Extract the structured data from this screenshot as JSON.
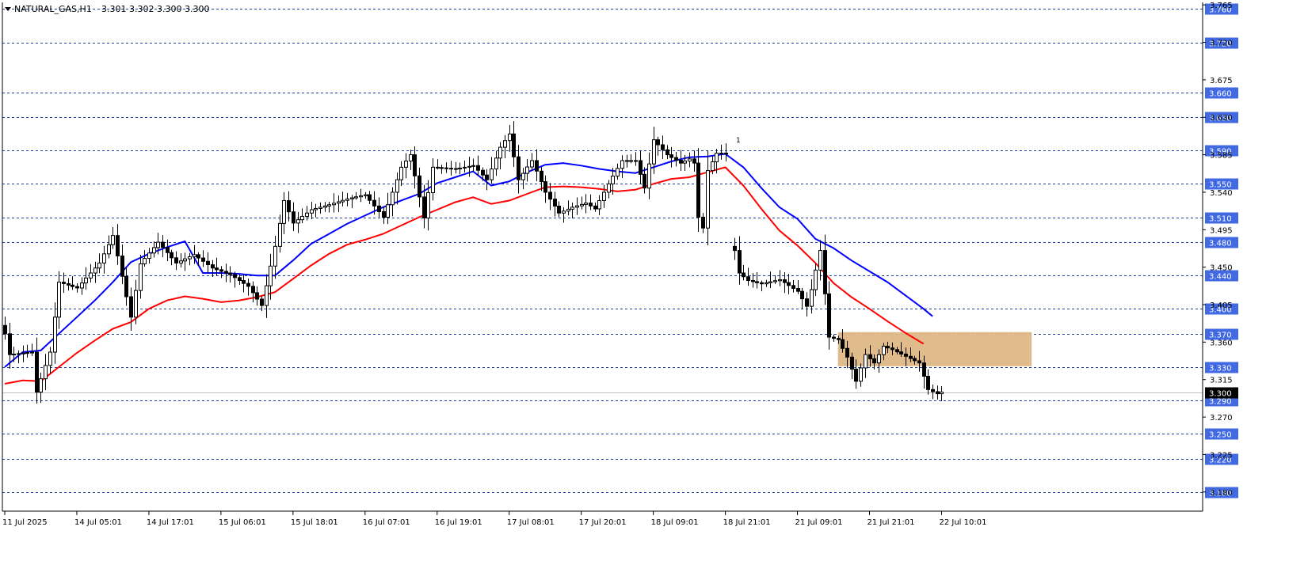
{
  "chart_data": {
    "type": "candlestick",
    "title": "NATURAL_GAS,H1",
    "ohlc_readout": "3.301 3.302 3.300 3.300",
    "current_price": 3.3,
    "ylim": [
      3.157,
      3.768
    ],
    "y_ticks": [
      3.18,
      3.225,
      3.27,
      3.315,
      3.36,
      3.405,
      3.45,
      3.495,
      3.54,
      3.585,
      3.63,
      3.675,
      3.72,
      3.765
    ],
    "x_ticks": [
      {
        "label": "11 Jul 2025",
        "bar": 0
      },
      {
        "label": "14 Jul 05:01",
        "bar": 16
      },
      {
        "label": "14 Jul 17:01",
        "bar": 32
      },
      {
        "label": "15 Jul 06:01",
        "bar": 48
      },
      {
        "label": "15 Jul 18:01",
        "bar": 64
      },
      {
        "label": "16 Jul 07:01",
        "bar": 80
      },
      {
        "label": "16 Jul 19:01",
        "bar": 96
      },
      {
        "label": "17 Jul 08:01",
        "bar": 112
      },
      {
        "label": "17 Jul 20:01",
        "bar": 128
      },
      {
        "label": "18 Jul 09:01",
        "bar": 144
      },
      {
        "label": "18 Jul 21:01",
        "bar": 160
      },
      {
        "label": "21 Jul 09:01",
        "bar": 176
      },
      {
        "label": "21 Jul 21:01",
        "bar": 192
      },
      {
        "label": "22 Jul 10:01",
        "bar": 208
      }
    ],
    "levels": [
      3.76,
      3.72,
      3.66,
      3.63,
      3.59,
      3.55,
      3.51,
      3.48,
      3.44,
      3.4,
      3.37,
      3.33,
      3.29,
      3.25,
      3.22,
      3.18
    ],
    "zone": {
      "bar_start": 185,
      "bar_end": 228,
      "price_low": 3.331,
      "price_high": 3.372,
      "color": "#deb887"
    },
    "series": [
      {
        "key": "ma_fast",
        "color": "#0000ff",
        "points": [
          [
            0,
            3.33
          ],
          [
            4,
            3.348
          ],
          [
            8,
            3.35
          ],
          [
            12,
            3.37
          ],
          [
            16,
            3.39
          ],
          [
            20,
            3.41
          ],
          [
            24,
            3.432
          ],
          [
            28,
            3.456
          ],
          [
            32,
            3.466
          ],
          [
            36,
            3.474
          ],
          [
            40,
            3.481
          ],
          [
            44,
            3.443
          ],
          [
            48,
            3.443
          ],
          [
            52,
            3.442
          ],
          [
            56,
            3.44
          ],
          [
            60,
            3.44
          ],
          [
            64,
            3.458
          ],
          [
            68,
            3.478
          ],
          [
            72,
            3.49
          ],
          [
            76,
            3.502
          ],
          [
            80,
            3.512
          ],
          [
            84,
            3.522
          ],
          [
            88,
            3.53
          ],
          [
            92,
            3.538
          ],
          [
            96,
            3.551
          ],
          [
            100,
            3.558
          ],
          [
            104,
            3.565
          ],
          [
            108,
            3.548
          ],
          [
            112,
            3.553
          ],
          [
            116,
            3.564
          ],
          [
            120,
            3.573
          ],
          [
            124,
            3.575
          ],
          [
            128,
            3.572
          ],
          [
            132,
            3.568
          ],
          [
            136,
            3.565
          ],
          [
            140,
            3.563
          ],
          [
            144,
            3.57
          ],
          [
            148,
            3.577
          ],
          [
            152,
            3.582
          ],
          [
            156,
            3.583
          ],
          [
            160,
            3.586
          ],
          [
            164,
            3.57
          ],
          [
            168,
            3.545
          ],
          [
            172,
            3.522
          ],
          [
            176,
            3.508
          ],
          [
            180,
            3.484
          ],
          [
            184,
            3.473
          ],
          [
            188,
            3.458
          ],
          [
            192,
            3.445
          ],
          [
            196,
            3.432
          ],
          [
            200,
            3.416
          ],
          [
            204,
            3.4
          ],
          [
            206,
            3.391
          ]
        ]
      },
      {
        "key": "ma_slow",
        "color": "#ff0000",
        "points": [
          [
            0,
            3.31
          ],
          [
            4,
            3.314
          ],
          [
            8,
            3.313
          ],
          [
            12,
            3.33
          ],
          [
            16,
            3.347
          ],
          [
            20,
            3.362
          ],
          [
            24,
            3.376
          ],
          [
            28,
            3.384
          ],
          [
            32,
            3.4
          ],
          [
            36,
            3.41
          ],
          [
            40,
            3.415
          ],
          [
            44,
            3.412
          ],
          [
            48,
            3.408
          ],
          [
            52,
            3.41
          ],
          [
            56,
            3.414
          ],
          [
            60,
            3.42
          ],
          [
            64,
            3.436
          ],
          [
            68,
            3.452
          ],
          [
            72,
            3.466
          ],
          [
            76,
            3.477
          ],
          [
            80,
            3.483
          ],
          [
            84,
            3.49
          ],
          [
            88,
            3.5
          ],
          [
            92,
            3.51
          ],
          [
            96,
            3.519
          ],
          [
            100,
            3.528
          ],
          [
            104,
            3.534
          ],
          [
            108,
            3.526
          ],
          [
            112,
            3.53
          ],
          [
            116,
            3.538
          ],
          [
            120,
            3.546
          ],
          [
            124,
            3.547
          ],
          [
            128,
            3.546
          ],
          [
            132,
            3.544
          ],
          [
            136,
            3.541
          ],
          [
            140,
            3.543
          ],
          [
            144,
            3.55
          ],
          [
            148,
            3.556
          ],
          [
            152,
            3.558
          ],
          [
            156,
            3.564
          ],
          [
            160,
            3.57
          ],
          [
            164,
            3.548
          ],
          [
            168,
            3.52
          ],
          [
            172,
            3.494
          ],
          [
            176,
            3.476
          ],
          [
            180,
            3.455
          ],
          [
            184,
            3.431
          ],
          [
            188,
            3.414
          ],
          [
            192,
            3.4
          ],
          [
            196,
            3.385
          ],
          [
            200,
            3.371
          ],
          [
            204,
            3.358
          ]
        ]
      }
    ],
    "key_points": [
      [
        0,
        3.37
      ],
      [
        1,
        3.345
      ],
      [
        6,
        3.348
      ],
      [
        7,
        3.3
      ],
      [
        10,
        3.348
      ],
      [
        12,
        3.432
      ],
      [
        16,
        3.425
      ],
      [
        21,
        3.455
      ],
      [
        24,
        3.488
      ],
      [
        28,
        3.39
      ],
      [
        30,
        3.454
      ],
      [
        34,
        3.48
      ],
      [
        38,
        3.455
      ],
      [
        42,
        3.465
      ],
      [
        46,
        3.449
      ],
      [
        50,
        3.441
      ],
      [
        54,
        3.427
      ],
      [
        57,
        3.404
      ],
      [
        60,
        3.475
      ],
      [
        62,
        3.53
      ],
      [
        64,
        3.503
      ],
      [
        68,
        3.519
      ],
      [
        72,
        3.525
      ],
      [
        76,
        3.532
      ],
      [
        80,
        3.537
      ],
      [
        84,
        3.51
      ],
      [
        88,
        3.57
      ],
      [
        90,
        3.585
      ],
      [
        93,
        3.509
      ],
      [
        95,
        3.57
      ],
      [
        100,
        3.568
      ],
      [
        104,
        3.572
      ],
      [
        107,
        3.555
      ],
      [
        110,
        3.594
      ],
      [
        112,
        3.61
      ],
      [
        114,
        3.555
      ],
      [
        117,
        3.578
      ],
      [
        120,
        3.54
      ],
      [
        123,
        3.515
      ],
      [
        126,
        3.522
      ],
      [
        129,
        3.527
      ],
      [
        131,
        3.52
      ],
      [
        134,
        3.55
      ],
      [
        137,
        3.578
      ],
      [
        140,
        3.578
      ],
      [
        142,
        3.545
      ],
      [
        144,
        3.603
      ],
      [
        147,
        3.585
      ],
      [
        150,
        3.575
      ],
      [
        152,
        3.58
      ],
      [
        153,
        3.575
      ],
      [
        154,
        3.51
      ],
      [
        155,
        3.497
      ],
      [
        156,
        3.566
      ],
      [
        158,
        3.587
      ],
      [
        160,
        3.587
      ]
    ],
    "key_points_2": [
      [
        162,
        3.47
      ],
      [
        163,
        3.443
      ],
      [
        165,
        3.434
      ],
      [
        168,
        3.43
      ],
      [
        172,
        3.435
      ],
      [
        176,
        3.421
      ],
      [
        178,
        3.403
      ],
      [
        179,
        3.423
      ],
      [
        181,
        3.47
      ],
      [
        183,
        3.366
      ],
      [
        185,
        3.363
      ],
      [
        187,
        3.342
      ],
      [
        189,
        3.313
      ],
      [
        191,
        3.345
      ],
      [
        193,
        3.335
      ],
      [
        195,
        3.355
      ],
      [
        197,
        3.351
      ],
      [
        200,
        3.343
      ],
      [
        203,
        3.335
      ],
      [
        205,
        3.303
      ],
      [
        207,
        3.298
      ],
      [
        208,
        3.3
      ]
    ],
    "sparse_marker": {
      "bar": 162,
      "label": "1"
    }
  }
}
